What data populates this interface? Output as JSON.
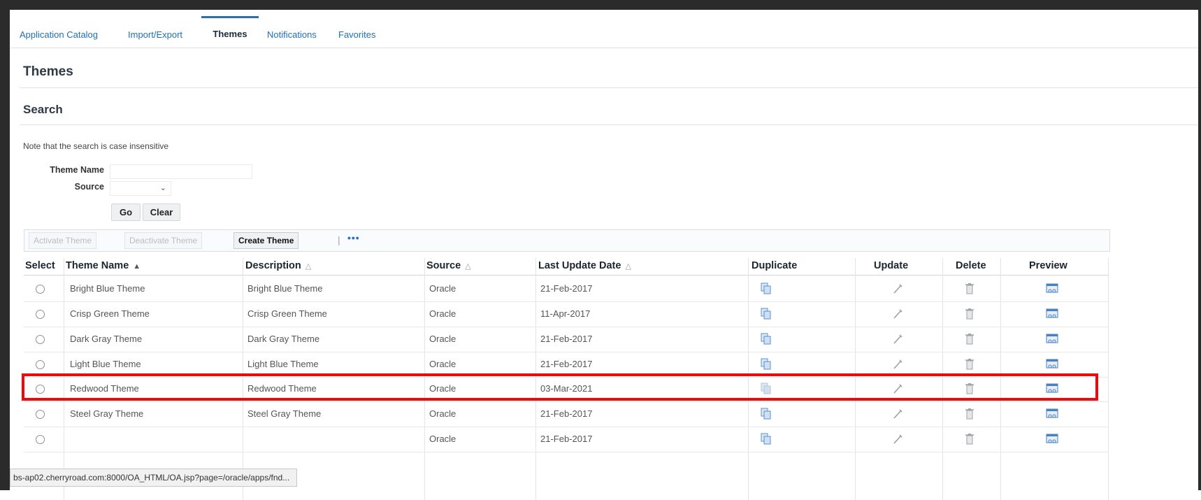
{
  "tabs": [
    {
      "label": "Application Catalog"
    },
    {
      "label": "Import/Export"
    },
    {
      "label": "Themes",
      "active": true
    },
    {
      "label": "Notifications"
    },
    {
      "label": "Favorites"
    }
  ],
  "page": {
    "title": "Themes",
    "search_header": "Search",
    "note": "Note that the search is case insensitive"
  },
  "search": {
    "theme_name_label": "Theme Name",
    "theme_name_value": "",
    "source_label": "Source",
    "source_value": "",
    "go_label": "Go",
    "clear_label": "Clear"
  },
  "toolbar": {
    "activate": "Activate Theme",
    "deactivate": "Deactivate Theme",
    "create": "Create Theme",
    "separator": "|",
    "more": "•••"
  },
  "table": {
    "headers": {
      "select": "Select",
      "theme_name": "Theme Name",
      "description": "Description",
      "source": "Source",
      "last_update": "Last Update Date",
      "duplicate": "Duplicate",
      "update": "Update",
      "delete": "Delete",
      "preview": "Preview"
    },
    "rows": [
      {
        "name": "Bright Blue Theme",
        "description": "Bright Blue Theme",
        "source": "Oracle",
        "date": "21-Feb-2017"
      },
      {
        "name": "Crisp Green Theme",
        "description": "Crisp Green Theme",
        "source": "Oracle",
        "date": "11-Apr-2017"
      },
      {
        "name": "Dark Gray Theme",
        "description": "Dark Gray Theme",
        "source": "Oracle",
        "date": "21-Feb-2017"
      },
      {
        "name": "Light Blue Theme",
        "description": "Light Blue Theme",
        "source": "Oracle",
        "date": "21-Feb-2017"
      },
      {
        "name": "Redwood Theme",
        "description": "Redwood Theme",
        "source": "Oracle",
        "date": "03-Mar-2021"
      },
      {
        "name": "Steel Gray Theme",
        "description": "Steel Gray Theme",
        "source": "Oracle",
        "date": "21-Feb-2017"
      },
      {
        "name": "",
        "description": "",
        "source": "Oracle",
        "date": "21-Feb-2017"
      }
    ]
  },
  "status_url": "bs-ap02.cherryroad.com:8000/OA_HTML/OA.jsp?page=/oracle/apps/fnd...",
  "colors": {
    "link": "#1f6fb5",
    "highlight_border": "#ee0a0a"
  }
}
